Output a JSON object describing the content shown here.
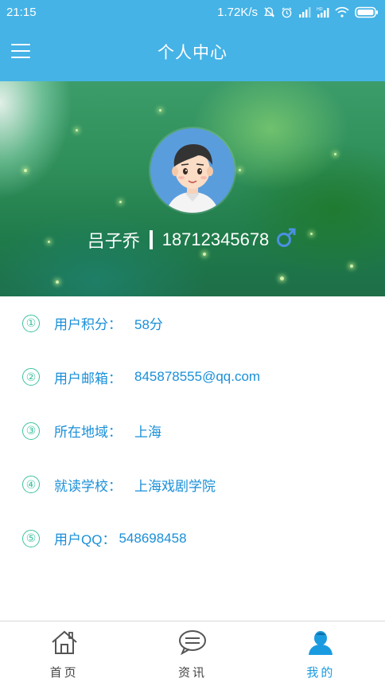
{
  "status_bar": {
    "time": "21:15",
    "network_speed": "1.72K/s"
  },
  "app_bar": {
    "title": "个人中心",
    "menu_icon": "hamburger-menu-icon"
  },
  "profile": {
    "name": "吕子乔",
    "phone": "18712345678",
    "gender_icon": "male-symbol-icon",
    "gender_color": "#4a90e2"
  },
  "info_items": [
    {
      "num": "①",
      "label": "用户积分：",
      "value": "58分"
    },
    {
      "num": "②",
      "label": "用户邮箱：",
      "value": "845878555@qq.com"
    },
    {
      "num": "③",
      "label": "所在地域：",
      "value": "上海"
    },
    {
      "num": "④",
      "label": "就读学校：",
      "value": "上海戏剧学院"
    },
    {
      "num": "⑤",
      "label": "用户QQ：",
      "value": "548698458"
    }
  ],
  "tabs": [
    {
      "label": "首页",
      "icon": "home-icon",
      "active": false
    },
    {
      "label": "资讯",
      "icon": "chat-bubble-icon",
      "active": false
    },
    {
      "label": "我的",
      "icon": "user-icon",
      "active": true
    }
  ],
  "colors": {
    "header_blue": "#45b3e6",
    "accent_blue": "#1a9be0",
    "number_green": "#3cc2a0"
  }
}
